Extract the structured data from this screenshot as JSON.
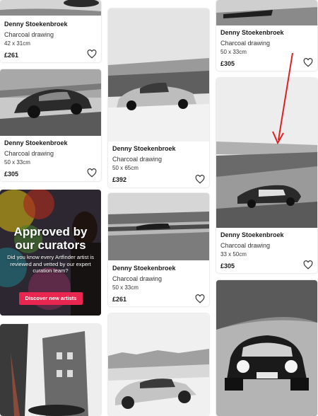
{
  "cards": [
    {
      "artist": "Denny Stoekenbroek",
      "medium": "Charcoal drawing",
      "size": "42 x 31cm",
      "price": "£261"
    },
    {
      "artist": "Denny Stoekenbroek",
      "medium": "Charcoal drawing",
      "size": "50 x 33cm",
      "price": "£305"
    },
    {
      "artist": "Denny Stoekenbroek",
      "medium": "Charcoal drawing",
      "size": "50 x 65cm",
      "price": "£392"
    },
    {
      "artist": "Denny Stoekenbroek",
      "medium": "Charcoal drawing",
      "size": "50 x 33cm",
      "price": "£261"
    },
    {
      "artist": "Denny Stoekenbroek",
      "medium": "Charcoal drawing",
      "size": "50 x 33cm",
      "price": "£305"
    },
    {
      "artist": "Denny Stoekenbroek",
      "medium": "Charcoal drawing",
      "size": "33 x 50cm",
      "price": "£305"
    }
  ],
  "promo": {
    "title_line1": "Approved by",
    "title_line2": "our curators",
    "text": "Did you know every Artfinder artist is reviewed and vetted by our expert curation team?",
    "button": "Discover new artists"
  },
  "colors": {
    "accent": "#e8264f",
    "annotation_arrow": "#e02020"
  },
  "icons": [
    "heart-icon",
    "annotation-arrow"
  ]
}
